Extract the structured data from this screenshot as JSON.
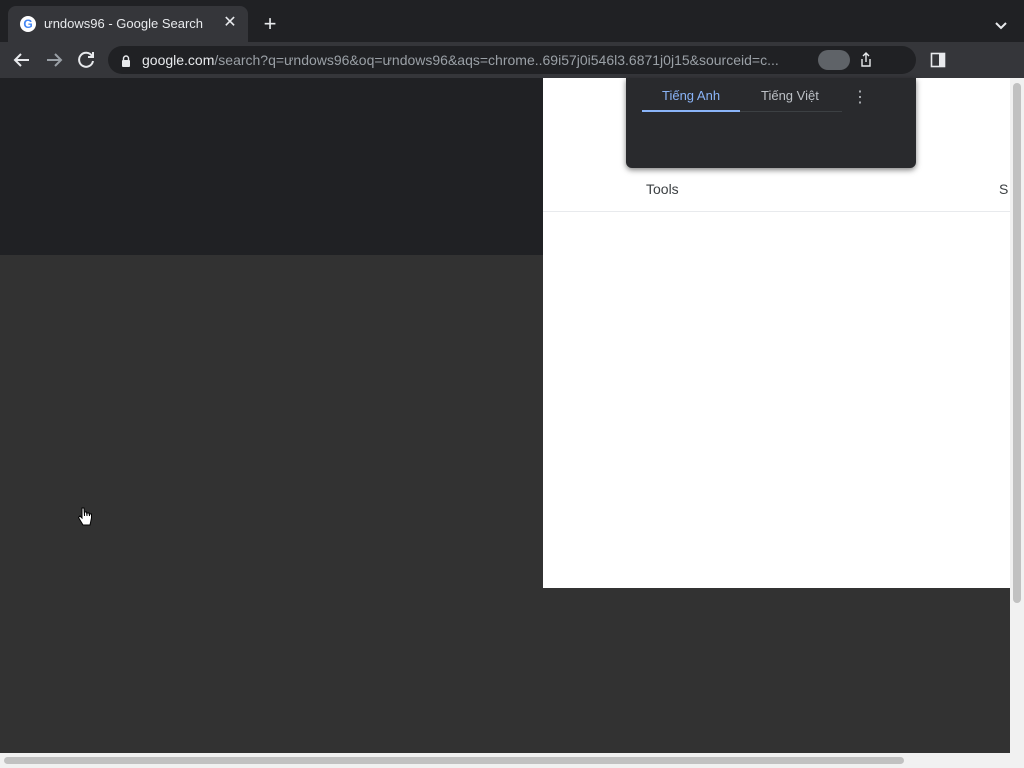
{
  "tab": {
    "title": "ưndows96 - Google Search",
    "close": "✕",
    "favicon": "google-g-icon"
  },
  "tabstrip": {
    "new_tab": "+"
  },
  "omnibox": {
    "host": "google.com",
    "path": "/search?q=ưndows96&oq=ưndows96&aqs=chrome..69i57j0i546l3.6871j0j15&sourceid=c..."
  },
  "translate_popup": {
    "tabs": [
      {
        "label": "Tiếng Anh",
        "active": true
      },
      {
        "label": "Tiếng Việt",
        "active": false
      }
    ],
    "menu": "⋮"
  },
  "page": {
    "tools_label": "Tools",
    "partial_label": "S"
  },
  "colors": {
    "accent": "#8ab4f8",
    "frame": "#202124",
    "toolbar": "#35363a"
  }
}
